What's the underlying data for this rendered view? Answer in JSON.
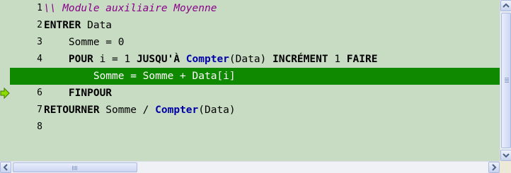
{
  "editor": {
    "current_line": 5,
    "lines": [
      {
        "number": "1",
        "tokens": [
          {
            "text": "\\\\ Module auxiliaire Moyenne",
            "type": "comment"
          }
        ]
      },
      {
        "number": "2",
        "tokens": [
          {
            "text": "ENTRER",
            "type": "keyword"
          },
          {
            "text": " Data",
            "type": "text"
          }
        ]
      },
      {
        "number": "3",
        "tokens": [
          {
            "text": "    Somme = 0",
            "type": "text"
          }
        ]
      },
      {
        "number": "4",
        "tokens": [
          {
            "text": "    ",
            "type": "text"
          },
          {
            "text": "POUR",
            "type": "keyword"
          },
          {
            "text": " i = 1 ",
            "type": "text"
          },
          {
            "text": "JUSQU'À",
            "type": "keyword"
          },
          {
            "text": " ",
            "type": "text"
          },
          {
            "text": "Compter",
            "type": "function"
          },
          {
            "text": "(Data) ",
            "type": "text"
          },
          {
            "text": "INCRÉMENT",
            "type": "keyword"
          },
          {
            "text": " 1 ",
            "type": "text"
          },
          {
            "text": "FAIRE",
            "type": "keyword"
          }
        ]
      },
      {
        "number": "5",
        "tokens": [
          {
            "text": "        Somme = Somme + Data[i]",
            "type": "text"
          }
        ]
      },
      {
        "number": "6",
        "tokens": [
          {
            "text": "    ",
            "type": "text"
          },
          {
            "text": "FINPOUR",
            "type": "keyword"
          }
        ]
      },
      {
        "number": "7",
        "tokens": [
          {
            "text": "RETOURNER",
            "type": "keyword"
          },
          {
            "text": " Somme / ",
            "type": "text"
          },
          {
            "text": "Compter",
            "type": "function"
          },
          {
            "text": "(Data)",
            "type": "text"
          }
        ]
      },
      {
        "number": "8",
        "tokens": []
      }
    ]
  },
  "icons": {
    "execution_pointer": "green-arrow-icon",
    "scroll_up": "arrow-up-icon",
    "scroll_down": "arrow-down-icon",
    "scroll_left": "arrow-left-icon",
    "scroll_right": "arrow-right-icon"
  },
  "colors": {
    "editor_background": "#c7dcc3",
    "current_line_highlight": "#0f8a00",
    "keyword": "#000000",
    "function": "#0000a8",
    "comment": "#8a008a",
    "pointer_arrow": "#7fd000"
  }
}
